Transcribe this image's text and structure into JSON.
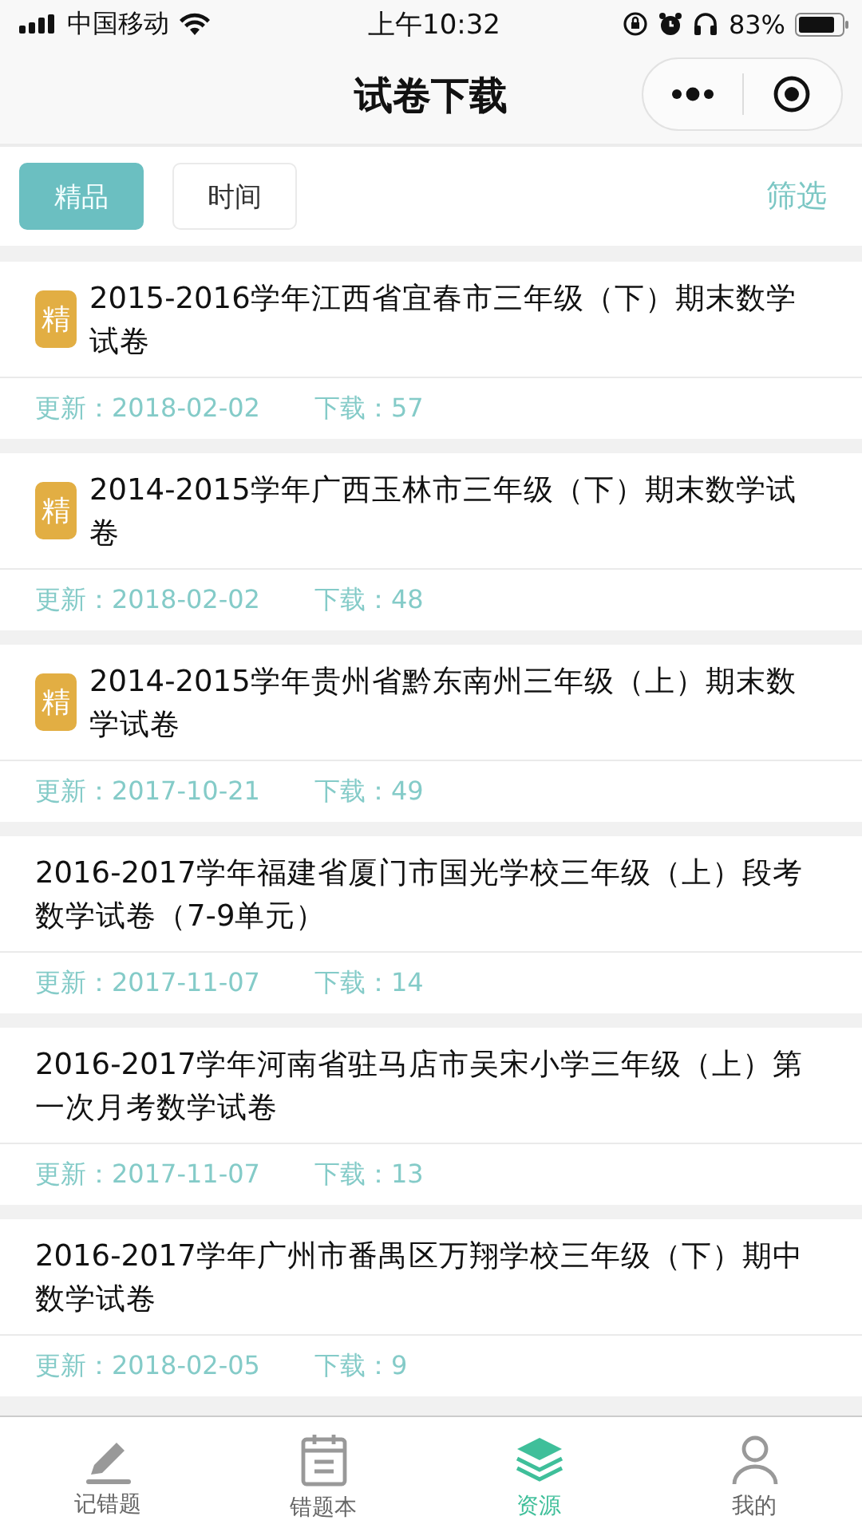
{
  "status_bar": {
    "carrier": "中国移动",
    "time": "上午10:32",
    "battery": "83%"
  },
  "header": {
    "title": "试卷下载"
  },
  "filter_tabs": [
    {
      "label": "精品",
      "selected": true
    },
    {
      "label": "时间",
      "selected": false
    }
  ],
  "filter_link": "筛选",
  "papers": [
    {
      "badge": "精",
      "title": "2015-2016学年江西省宜春市三年级（下）期末数学试卷",
      "updated": "更新：2018-02-02",
      "downloads": "下载：57"
    },
    {
      "badge": "精",
      "title": "2014-2015学年广西玉林市三年级（下）期末数学试卷",
      "updated": "更新：2018-02-02",
      "downloads": "下载：48"
    },
    {
      "badge": "精",
      "title": "2014-2015学年贵州省黔东南州三年级（上）期末数学试卷",
      "updated": "更新：2017-10-21",
      "downloads": "下载：49"
    },
    {
      "title": "2016-2017学年福建省厦门市国光学校三年级（上）段考数学试卷（7-9单元）",
      "updated": "更新：2017-11-07",
      "downloads": "下载：14"
    },
    {
      "title": "2016-2017学年河南省驻马店市吴宋小学三年级（上）第一次月考数学试卷",
      "updated": "更新：2017-11-07",
      "downloads": "下载：13"
    },
    {
      "title": "2016-2017学年广州市番禺区万翔学校三年级（下）期中数学试卷",
      "updated": "更新：2018-02-05",
      "downloads": "下载：9"
    }
  ],
  "tab_bar": [
    {
      "label": "记错题",
      "kind": "pencil",
      "selected": false
    },
    {
      "label": "错题本",
      "kind": "notebook",
      "selected": false
    },
    {
      "label": "资源",
      "kind": "stack",
      "selected": true
    },
    {
      "label": "我的",
      "kind": "person",
      "selected": false
    }
  ]
}
